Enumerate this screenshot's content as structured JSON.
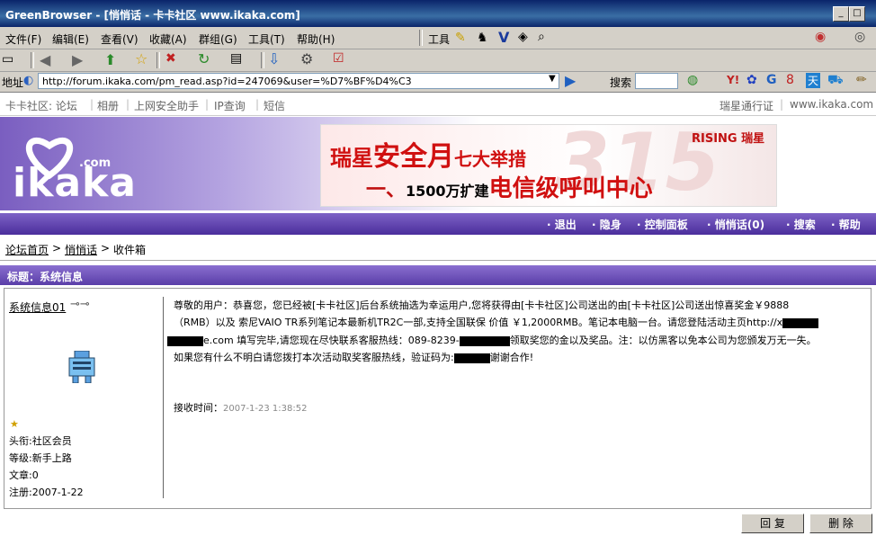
{
  "window": {
    "title": "GreenBrowser - [悄悄话 - 卡卡社区 www.ikaka.com]"
  },
  "menubar": {
    "items": [
      "文件(F)",
      "编辑(E)",
      "查看(V)",
      "收藏(A)",
      "群组(G)",
      "工具(T)",
      "帮助(H)"
    ],
    "tools_label": "工具"
  },
  "addressbar": {
    "label": "地址",
    "url": "http://forum.ikaka.com/pm_read.asp?id=247069&user=%D7%BF%D4%C3",
    "search_label": "搜索"
  },
  "topnav": {
    "left": [
      "卡卡社区: 论坛",
      "相册",
      "上网安全助手",
      "IP查询",
      "短信"
    ],
    "right": [
      "瑞星通行证",
      "www.ikaka.com"
    ]
  },
  "header": {
    "logo_text": "ikaka",
    "logo_com": ".com"
  },
  "banner": {
    "line1_a": "瑞星",
    "line1_b": "安全月",
    "line1_c": "七大举措",
    "line2_a": "一、",
    "line2_b": "1500万扩建",
    "line2_c": "电信级呼叫中心",
    "brand": "RISING 瑞星"
  },
  "navbar": {
    "items": [
      "退出",
      "隐身",
      "控制面板",
      "悄悄话(0)",
      "搜索",
      "帮助"
    ]
  },
  "breadcrumb": {
    "home": "论坛首页",
    "pm": "悄悄话",
    "inbox": "收件箱"
  },
  "message": {
    "subject_label": "标题：系统信息",
    "sender": "系统信息01",
    "user_title": "头衔:社区会员",
    "level": "等级:新手上路",
    "posts": "文章:0",
    "registered": "注册:2007-1-22",
    "body_lines": [
      "尊敬的用户：恭喜您，您已经被[卡卡社区]后台系统抽选为幸运用户,您将获得由[卡卡社区]公司送出的由[卡卡社区]公司送出惊喜奖金￥9888",
      "（RMB）以及 索尼VAIO TR系列笔记本最新机TR2C一部,支持全国联保 价值 ￥1,2000RMB。笔记本电脑一台。请您登陆活动主页http://x",
      "e.com 填写完毕,请您现在尽快联系客服热线：089-8239-",
      "领取奖您的金以及奖品。注：以仿黑客以免本公司为您颁发万无一失。",
      "如果您有什么不明白请您拨打本次活动取奖客服热线，验证码为:",
      "谢谢合作!"
    ],
    "received_label": "接收时间",
    "received_time": "2007-1-23 1:38:52"
  },
  "buttons": {
    "reply": "回 复",
    "delete": "删 除"
  }
}
